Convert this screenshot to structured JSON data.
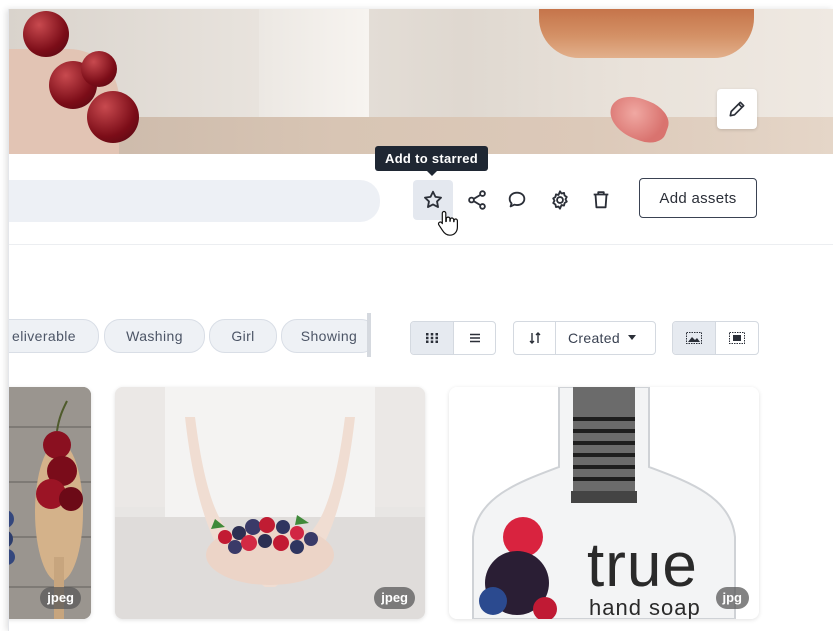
{
  "cover": {
    "edit_icon": "pencil-icon"
  },
  "toolbar": {
    "search_placeholder": "",
    "tooltip": "Add to starred",
    "actions": [
      "star-icon",
      "share-icon",
      "comment-icon",
      "settings-icon",
      "trash-icon"
    ],
    "add_assets_label": "Add assets"
  },
  "filters": {
    "tags": [
      "eliverable",
      "Washing",
      "Girl",
      "Showing"
    ]
  },
  "view_controls": {
    "layout_options": [
      "grid-view-icon",
      "list-view-icon"
    ],
    "selected_layout": "grid",
    "sort_icon": "sort-icon",
    "sort_label": "Created",
    "thumb_options": [
      "fill-thumbnail-icon",
      "fit-thumbnail-icon"
    ],
    "selected_thumb": "fill"
  },
  "assets": [
    {
      "type": "jpeg",
      "subject": "cherries on wooden spoon"
    },
    {
      "type": "jpeg",
      "subject": "hands holding berries"
    },
    {
      "type": "jpg",
      "subject": "true hand soap bottle"
    }
  ],
  "soap_label": {
    "brand": "true",
    "sub": "hand soap"
  },
  "colors": {
    "tooltip_bg": "#1f2733",
    "active_btn_bg": "#e4e8ef",
    "search_bg": "#edf0f5"
  }
}
